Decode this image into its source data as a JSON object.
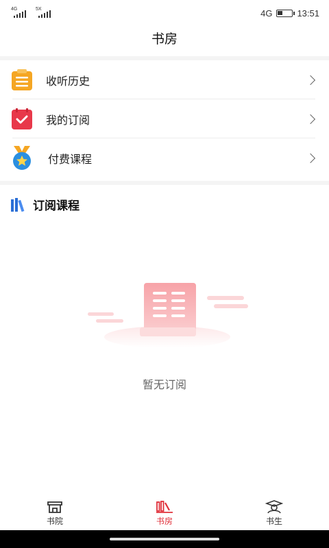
{
  "status": {
    "sim1_tag": "4G",
    "sim2_tag": "5X",
    "network": "4G",
    "time": "13:51",
    "battery_level": 0.3
  },
  "header": {
    "title": "书房"
  },
  "menu": {
    "items": [
      {
        "label": "收听历史",
        "icon": "clipboard-list-icon",
        "color": "#f5a623"
      },
      {
        "label": "我的订阅",
        "icon": "calendar-check-icon",
        "color": "#e8384a"
      },
      {
        "label": "付费课程",
        "icon": "medal-star-icon",
        "color": "#2b8fe0"
      }
    ]
  },
  "section": {
    "title": "订阅课程",
    "icon": "books-icon"
  },
  "empty_state": {
    "text": "暂无订阅",
    "icon": "empty-document-illustration"
  },
  "tabbar": {
    "tabs": [
      {
        "label": "书院",
        "icon": "academy-icon",
        "active": false
      },
      {
        "label": "书房",
        "icon": "bookshelf-icon",
        "active": true
      },
      {
        "label": "书生",
        "icon": "scholar-icon",
        "active": false
      }
    ],
    "active_color": "#e0303a"
  }
}
